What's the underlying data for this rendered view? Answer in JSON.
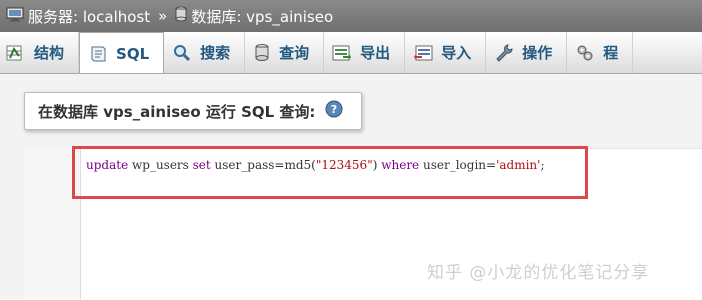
{
  "breadcrumb": {
    "server_label": "服务器: localhost",
    "separator": "»",
    "database_label": "数据库: vps_ainiseo"
  },
  "tabs": [
    {
      "label": "结构",
      "icon": "structure-icon",
      "active": false
    },
    {
      "label": "SQL",
      "icon": "sql-icon",
      "active": true
    },
    {
      "label": "搜索",
      "icon": "search-icon",
      "active": false
    },
    {
      "label": "查询",
      "icon": "query-icon",
      "active": false
    },
    {
      "label": "导出",
      "icon": "export-icon",
      "active": false
    },
    {
      "label": "导入",
      "icon": "import-icon",
      "active": false
    },
    {
      "label": "操作",
      "icon": "wrench-icon",
      "active": false
    },
    {
      "label": "程",
      "icon": "routines-icon",
      "active": false
    }
  ],
  "query_panel": {
    "title": "在数据库 vps_ainiseo 运行 SQL 查询:"
  },
  "editor": {
    "code": {
      "t1": "update",
      "t2": " wp_users ",
      "t3": "set",
      "t4": " user_pass=md5(",
      "t5": "\"123456\"",
      "t6": ") ",
      "t7": "where",
      "t8": " user_login=",
      "t9": "'admin'",
      "t10": ";"
    }
  },
  "watermark": "知乎 @小龙的优化笔记分享",
  "colors": {
    "topbar": "#7a7a7a",
    "tab_text": "#235a81",
    "keyword": "#770088",
    "string": "#aa1111",
    "highlight_border": "#d94a4a"
  }
}
